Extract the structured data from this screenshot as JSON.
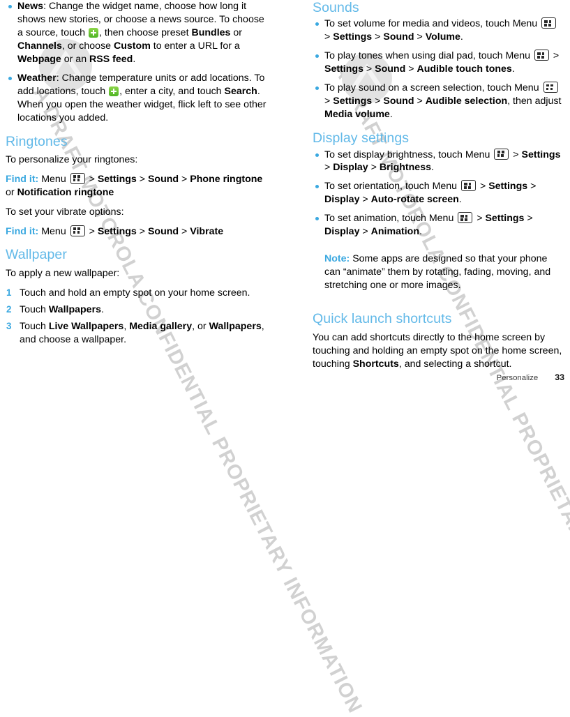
{
  "watermark": {
    "text": "A DRAFT MOTOROLA CONFIDENTIAL PROPRIETARY INFORMATION",
    "logo_name": "motorola-batwing-logo",
    "color": "#c9c9c9"
  },
  "colors": {
    "heading": "#62b9e8",
    "accent": "#3aa8e0",
    "body": "#000000",
    "plus_icon_green": "#4eb424"
  },
  "icons": {
    "menu": "menu-grid-icon",
    "plus": "green-plus-icon"
  },
  "left_column": {
    "widget_bullets": [
      {
        "id": "news",
        "segments": [
          {
            "t": "News",
            "s": "bold"
          },
          {
            "t": ": Change the widget name, choose how long it shows new stories, or choose a news source. To choose a source, touch ",
            "s": "normal"
          },
          {
            "t": "",
            "s": "icon-plus"
          },
          {
            "t": ", then choose preset ",
            "s": "normal"
          },
          {
            "t": "Bundles",
            "s": "bold"
          },
          {
            "t": " or ",
            "s": "normal"
          },
          {
            "t": "Channels",
            "s": "bold"
          },
          {
            "t": ", or choose ",
            "s": "normal"
          },
          {
            "t": "Custom",
            "s": "bold"
          },
          {
            "t": " to enter a URL for a ",
            "s": "normal"
          },
          {
            "t": "Webpage",
            "s": "bold"
          },
          {
            "t": " or an ",
            "s": "normal"
          },
          {
            "t": "RSS feed",
            "s": "bold"
          },
          {
            "t": ".",
            "s": "normal"
          }
        ]
      },
      {
        "id": "weather",
        "segments": [
          {
            "t": "Weather",
            "s": "bold"
          },
          {
            "t": ": Change temperature units or add locations. To add locations, touch ",
            "s": "normal"
          },
          {
            "t": "",
            "s": "icon-plus"
          },
          {
            "t": ", enter a city, and touch ",
            "s": "normal"
          },
          {
            "t": "Search",
            "s": "bold"
          },
          {
            "t": ". When you open the weather widget, flick left to see other locations you added.",
            "s": "normal"
          }
        ]
      }
    ],
    "ringtones": {
      "heading": "Ringtones",
      "intro": "To personalize your ringtones:",
      "findit_1": {
        "label": "Find it:",
        "segments": [
          {
            "t": " Menu ",
            "s": "normal"
          },
          {
            "t": "",
            "s": "icon-menu"
          },
          {
            "t": " > ",
            "s": "normal"
          },
          {
            "t": "Settings",
            "s": "bold"
          },
          {
            "t": " > ",
            "s": "normal"
          },
          {
            "t": "Sound",
            "s": "bold"
          },
          {
            "t": " > ",
            "s": "normal"
          },
          {
            "t": "Phone ringtone",
            "s": "bold"
          },
          {
            "t": " or ",
            "s": "normal"
          },
          {
            "t": "Notification ringtone",
            "s": "bold"
          }
        ]
      },
      "intro_2": "To set your vibrate options:",
      "findit_2": {
        "label": "Find it:",
        "segments": [
          {
            "t": " Menu ",
            "s": "normal"
          },
          {
            "t": "",
            "s": "icon-menu"
          },
          {
            "t": " > ",
            "s": "normal"
          },
          {
            "t": "Settings",
            "s": "bold"
          },
          {
            "t": " > ",
            "s": "normal"
          },
          {
            "t": "Sound",
            "s": "bold"
          },
          {
            "t": " > ",
            "s": "normal"
          },
          {
            "t": "Vibrate",
            "s": "bold"
          }
        ]
      }
    },
    "wallpaper": {
      "heading": "Wallpaper",
      "intro": "To apply a new wallpaper:",
      "steps": [
        {
          "n": "1",
          "segments": [
            {
              "t": "Touch and hold an empty spot on your home screen.",
              "s": "normal"
            }
          ]
        },
        {
          "n": "2",
          "segments": [
            {
              "t": "Touch ",
              "s": "normal"
            },
            {
              "t": "Wallpapers",
              "s": "bold"
            },
            {
              "t": ".",
              "s": "normal"
            }
          ]
        },
        {
          "n": "3",
          "segments": [
            {
              "t": "Touch ",
              "s": "normal"
            },
            {
              "t": "Live Wallpapers",
              "s": "bold"
            },
            {
              "t": ", ",
              "s": "normal"
            },
            {
              "t": "Media gallery",
              "s": "bold"
            },
            {
              "t": ", or ",
              "s": "normal"
            },
            {
              "t": "Wallpapers",
              "s": "bold"
            },
            {
              "t": ", and choose a wallpaper.",
              "s": "normal"
            }
          ]
        }
      ]
    }
  },
  "right_column": {
    "sounds": {
      "heading": "Sounds",
      "bullets": [
        {
          "segments": [
            {
              "t": "To set volume for media and videos, touch Menu ",
              "s": "normal"
            },
            {
              "t": "",
              "s": "icon-menu"
            },
            {
              "t": " > ",
              "s": "normal"
            },
            {
              "t": "Settings",
              "s": "bold"
            },
            {
              "t": " > ",
              "s": "normal"
            },
            {
              "t": "Sound",
              "s": "bold"
            },
            {
              "t": " > ",
              "s": "normal"
            },
            {
              "t": "Volume",
              "s": "bold"
            },
            {
              "t": ".",
              "s": "normal"
            }
          ]
        },
        {
          "segments": [
            {
              "t": "To play tones when using dial pad, touch Menu ",
              "s": "normal"
            },
            {
              "t": "",
              "s": "icon-menu"
            },
            {
              "t": " > ",
              "s": "normal"
            },
            {
              "t": "Settings",
              "s": "bold"
            },
            {
              "t": " > ",
              "s": "normal"
            },
            {
              "t": "Sound",
              "s": "bold"
            },
            {
              "t": " > ",
              "s": "normal"
            },
            {
              "t": "Audible touch tones",
              "s": "bold"
            },
            {
              "t": ".",
              "s": "normal"
            }
          ]
        },
        {
          "segments": [
            {
              "t": "To play sound on a screen selection, touch Menu ",
              "s": "normal"
            },
            {
              "t": "",
              "s": "icon-menu"
            },
            {
              "t": " > ",
              "s": "normal"
            },
            {
              "t": "Settings",
              "s": "bold"
            },
            {
              "t": " > ",
              "s": "normal"
            },
            {
              "t": "Sound",
              "s": "bold"
            },
            {
              "t": " > ",
              "s": "normal"
            },
            {
              "t": "Audible selection",
              "s": "bold"
            },
            {
              "t": ", then adjust ",
              "s": "normal"
            },
            {
              "t": "Media volume",
              "s": "bold"
            },
            {
              "t": ".",
              "s": "normal"
            }
          ]
        }
      ]
    },
    "display_settings": {
      "heading": "Display settings",
      "bullets": [
        {
          "segments": [
            {
              "t": "To set display brightness, touch Menu ",
              "s": "normal"
            },
            {
              "t": "",
              "s": "icon-menu"
            },
            {
              "t": " > ",
              "s": "normal"
            },
            {
              "t": "Settings",
              "s": "bold"
            },
            {
              "t": " > ",
              "s": "normal"
            },
            {
              "t": "Display",
              "s": "bold"
            },
            {
              "t": " > ",
              "s": "normal"
            },
            {
              "t": "Brightness",
              "s": "bold"
            },
            {
              "t": ".",
              "s": "normal"
            }
          ]
        },
        {
          "segments": [
            {
              "t": "To set orientation, touch Menu ",
              "s": "normal"
            },
            {
              "t": "",
              "s": "icon-menu"
            },
            {
              "t": " > ",
              "s": "normal"
            },
            {
              "t": "Settings",
              "s": "bold"
            },
            {
              "t": " > ",
              "s": "normal"
            },
            {
              "t": "Display",
              "s": "bold"
            },
            {
              "t": " > ",
              "s": "normal"
            },
            {
              "t": "Auto-rotate screen",
              "s": "bold"
            },
            {
              "t": ".",
              "s": "normal"
            }
          ]
        },
        {
          "segments": [
            {
              "t": "To set animation, touch Menu ",
              "s": "normal"
            },
            {
              "t": "",
              "s": "icon-menu"
            },
            {
              "t": " > ",
              "s": "normal"
            },
            {
              "t": "Settings",
              "s": "bold"
            },
            {
              "t": " > ",
              "s": "normal"
            },
            {
              "t": "Display",
              "s": "bold"
            },
            {
              "t": " > ",
              "s": "normal"
            },
            {
              "t": "Animation",
              "s": "bold"
            },
            {
              "t": ".",
              "s": "normal"
            }
          ]
        }
      ],
      "note": {
        "label": "Note:",
        "text": " Some apps are designed so that your phone can “animate” them by rotating, fading, moving, and stretching one or more images."
      }
    },
    "quick_launch": {
      "heading": "Quick launch shortcuts",
      "segments": [
        {
          "t": "You can add shortcuts directly to the home screen by touching and holding an empty spot on the home screen, touching ",
          "s": "normal"
        },
        {
          "t": "Shortcuts",
          "s": "bold"
        },
        {
          "t": ", and selecting a shortcut.",
          "s": "normal"
        }
      ]
    }
  },
  "footer": {
    "section_name": "Personalize",
    "page_number": "33"
  }
}
